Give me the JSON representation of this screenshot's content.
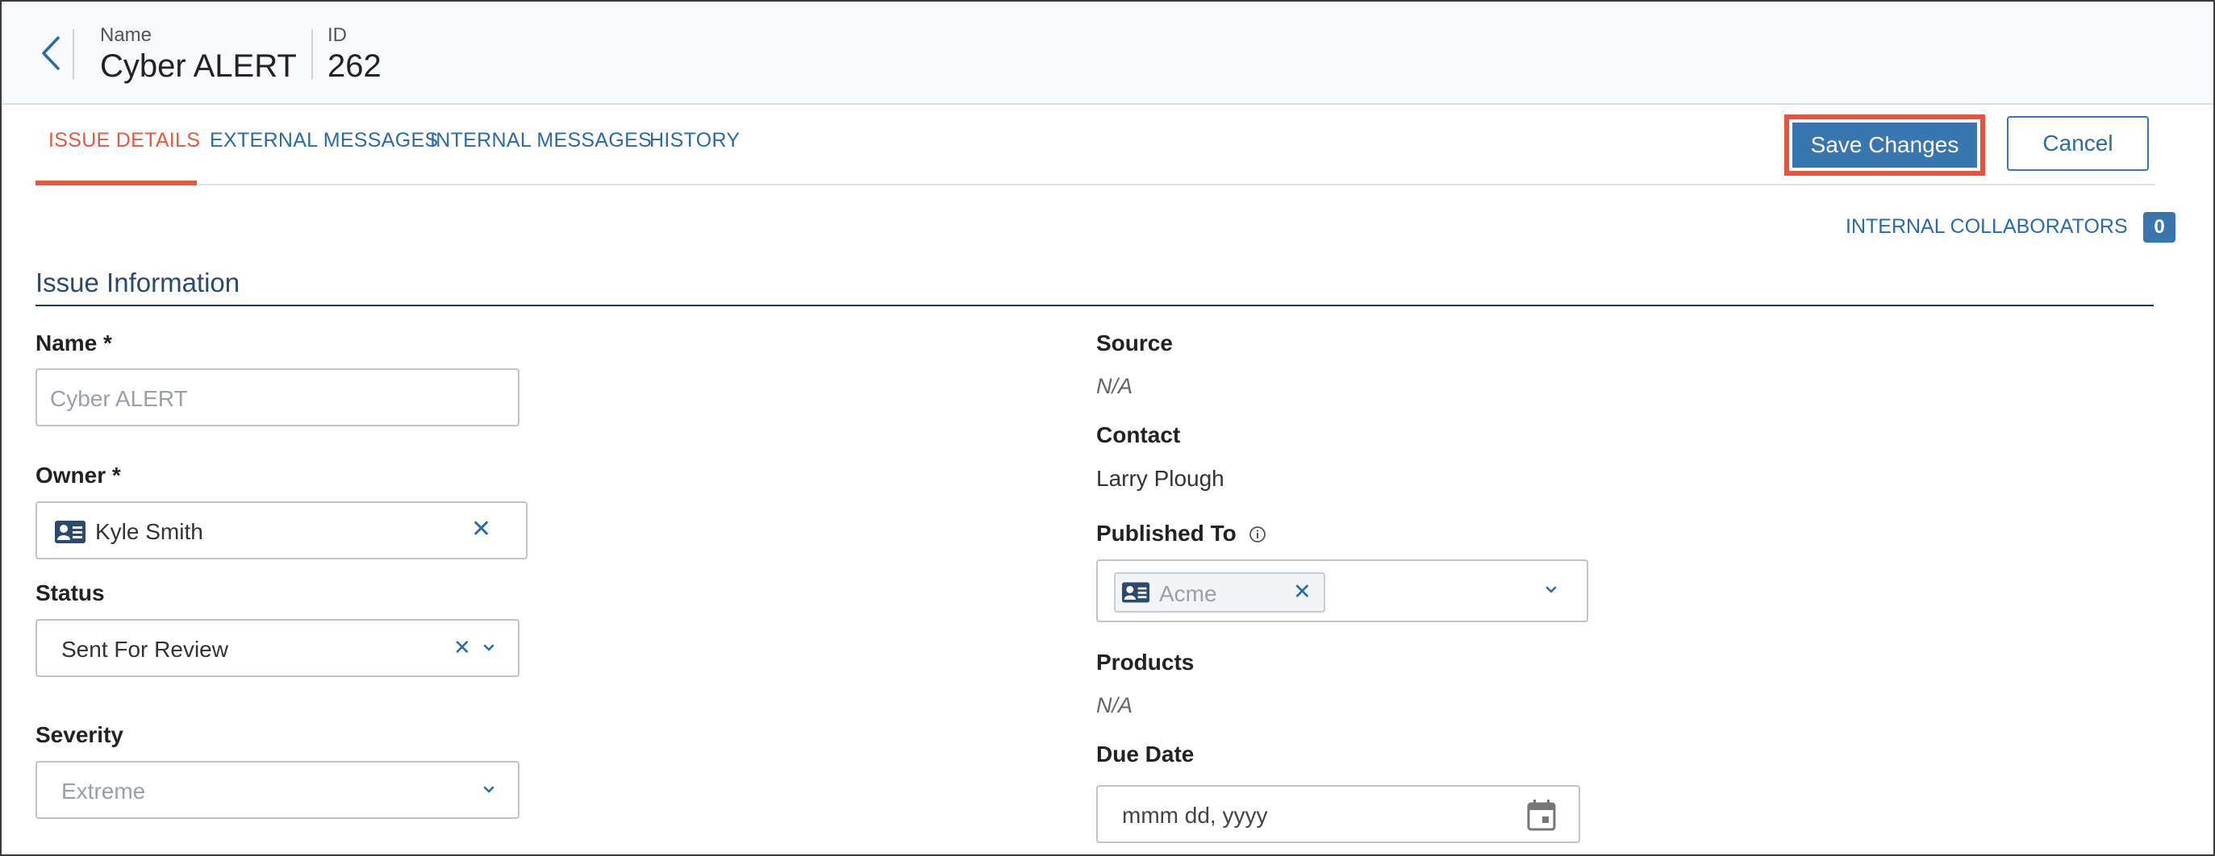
{
  "header": {
    "name_label": "Name",
    "name_value": "Cyber ALERT",
    "id_label": "ID",
    "id_value": "262"
  },
  "tabs": [
    {
      "label": "ISSUE DETAILS",
      "active": true
    },
    {
      "label": "EXTERNAL MESSAGES",
      "active": false
    },
    {
      "label": "INTERNAL MESSAGES",
      "active": false
    },
    {
      "label": "HISTORY",
      "active": false
    }
  ],
  "actions": {
    "save_label": "Save Changes",
    "cancel_label": "Cancel"
  },
  "collaborators": {
    "label": "INTERNAL COLLABORATORS",
    "count": "0"
  },
  "section": {
    "title": "Issue Information"
  },
  "form": {
    "name": {
      "label": "Name *",
      "placeholder": "Cyber ALERT"
    },
    "owner": {
      "label": "Owner *",
      "value": "Kyle Smith"
    },
    "status": {
      "label": "Status",
      "value": "Sent For Review"
    },
    "severity": {
      "label": "Severity",
      "value": "Extreme"
    },
    "source": {
      "label": "Source",
      "value": "N/A"
    },
    "contact": {
      "label": "Contact",
      "value": "Larry Plough"
    },
    "published_to": {
      "label": "Published To",
      "chip": "Acme"
    },
    "products": {
      "label": "Products",
      "value": "N/A"
    },
    "due_date": {
      "label": "Due Date",
      "placeholder": "mmm dd, yyyy"
    }
  },
  "colors": {
    "accent": "#3975ae",
    "active_tab": "#e25a3d",
    "link": "#2a6ba8",
    "highlight": "#e5543f"
  }
}
